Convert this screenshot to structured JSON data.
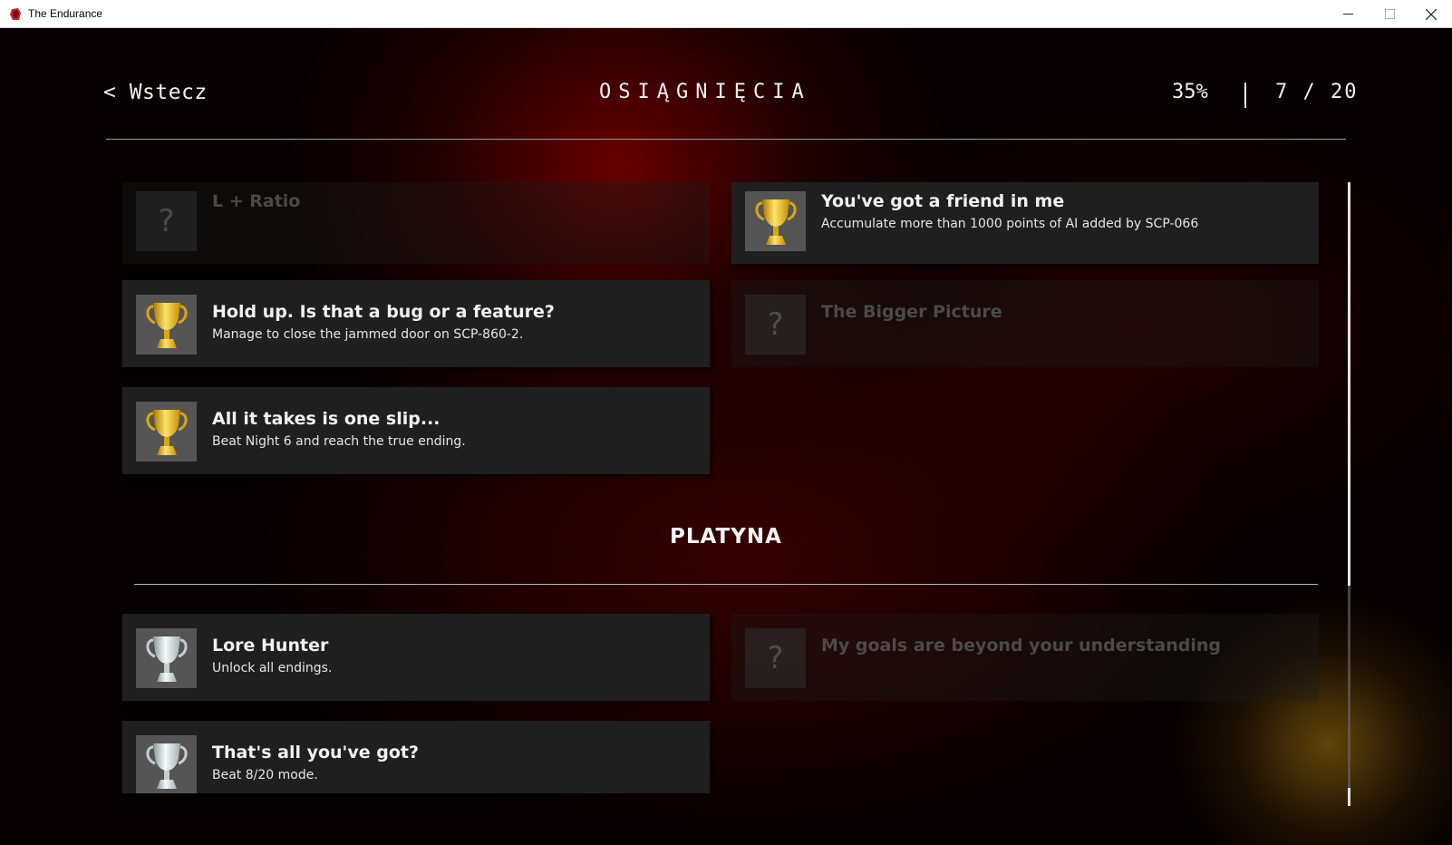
{
  "window": {
    "title": "The Endurance"
  },
  "header": {
    "back_label": "< Wstecz",
    "title": "OSIĄGNIĘCIA",
    "percent": "35%",
    "count": "7 / 20"
  },
  "achievements_top": [
    {
      "title": "L + Ratio",
      "description": "",
      "unlocked": false,
      "tier": "gold"
    },
    {
      "title": "You've got a friend in me",
      "description": "Accumulate more than 1000 points of AI added by SCP-066",
      "unlocked": true,
      "tier": "gold"
    },
    {
      "title": "Hold up. Is that a bug or a feature?",
      "description": "Manage to close the jammed door on SCP-860-2.",
      "unlocked": true,
      "tier": "gold"
    },
    {
      "title": "The Bigger Picture",
      "description": "",
      "unlocked": false,
      "tier": "gold"
    },
    {
      "title": "All it takes is one slip...",
      "description": "Beat Night 6 and reach the true ending.",
      "unlocked": true,
      "tier": "gold"
    }
  ],
  "platinum_section": {
    "title": "PLATYNA",
    "achievements": [
      {
        "title": "Lore Hunter",
        "description": "Unlock all endings.",
        "unlocked": true,
        "tier": "platinum"
      },
      {
        "title": "My goals are beyond your understanding",
        "description": "",
        "unlocked": false,
        "tier": "platinum"
      },
      {
        "title": "That's all you've got?",
        "description": "Beat 8/20 mode.",
        "unlocked": true,
        "tier": "platinum"
      }
    ]
  },
  "locked_icon": "question-mark-icon",
  "colors": {
    "gold": "#e8b92a",
    "platinum": "#cfd6d8",
    "accent_red": "#7a0000"
  }
}
